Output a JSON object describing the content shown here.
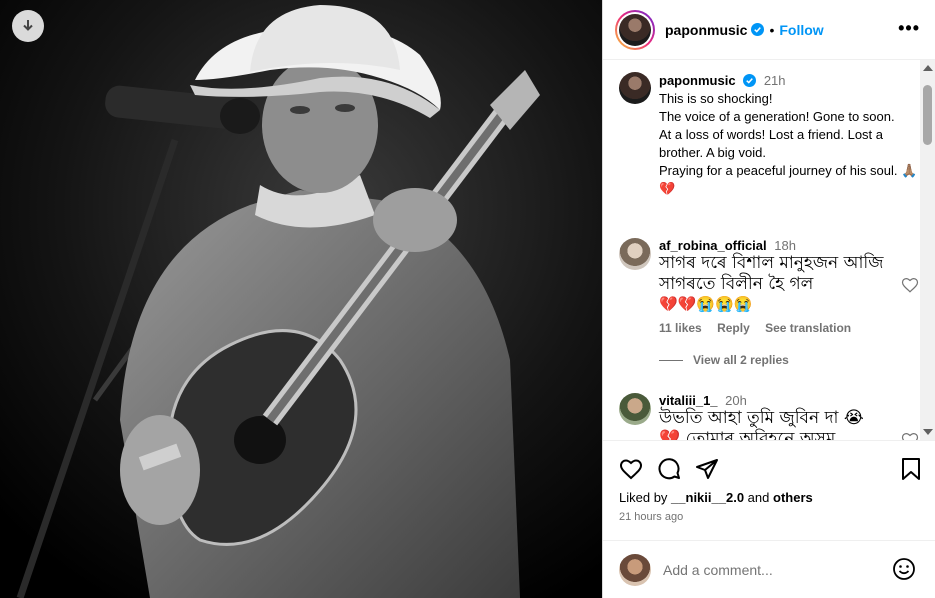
{
  "post": {
    "username": "paponmusic",
    "follow_label": "Follow",
    "separator": "•",
    "more_label": "•••"
  },
  "caption": {
    "username": "paponmusic",
    "time": "21h",
    "lines": [
      "This is so shocking!",
      "The voice of a generation! Gone to soon.",
      "At a loss of words! Lost a friend. Lost a brother. A big void.",
      "Praying for a peaceful journey of his soul. 🙏🏽💔"
    ]
  },
  "comments": [
    {
      "username": "af_robina_official",
      "time": "18h",
      "text": "সাগৰ দৰে বিশাল মানুহজন আজি সাগৰতে বিলীন হৈ গল",
      "emojis": "💔💔😭😭😭",
      "likes": "11 likes",
      "reply": "Reply",
      "translate": "See translation",
      "view_replies": "View all 2 replies"
    },
    {
      "username": "vitaliii_1_",
      "time": "20h",
      "text": "উভতি আহা তুমি জুবিন দা 😭",
      "text2": "💔 তোমাৰ অবিহনে অসম"
    }
  ],
  "likes": {
    "prefix": "Liked by",
    "user": "__nikii__2.0",
    "and": "and",
    "others": "others"
  },
  "posted_ago": "21 hours ago",
  "add_comment": {
    "placeholder": "Add a comment..."
  },
  "icons": {
    "download": "download-icon",
    "verified": "verified-icon",
    "like": "heart-icon",
    "comment": "comment-icon",
    "share": "share-icon",
    "save": "bookmark-icon",
    "emoji": "emoji-icon"
  },
  "colors": {
    "accent": "#0095f6",
    "verified": "#0095f6",
    "secondary_text": "#737373"
  }
}
